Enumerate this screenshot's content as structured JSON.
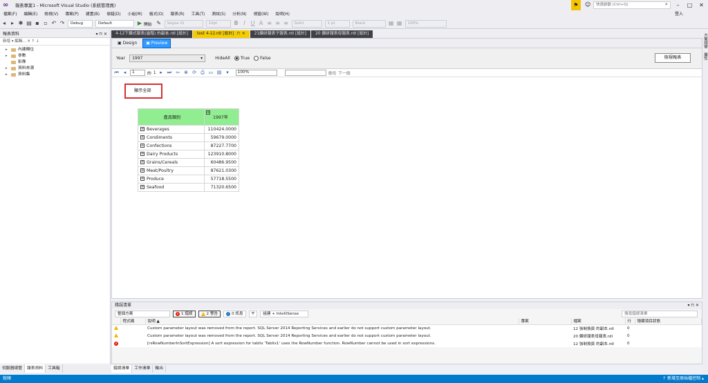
{
  "window": {
    "title": "報表專案1 - Microsoft Visual Studio (系統管理員)",
    "quick_launch_placeholder": "快速啟動 (Ctrl+Q)",
    "sign_in": "登入"
  },
  "menu": [
    "檔案(F)",
    "編輯(E)",
    "檢視(V)",
    "專案(P)",
    "建置(B)",
    "偵錯(D)",
    "小組(M)",
    "格式(O)",
    "報表(R)",
    "工具(T)",
    "測試(S)",
    "分析(N)",
    "視窗(W)",
    "說明(H)"
  ],
  "toolbar": {
    "config": "Debug",
    "platform": "Default",
    "start_label": "開始",
    "font": "Segoe UI",
    "font_size": "10pt",
    "border_style": "Solid",
    "border_width": "1 pt",
    "color": "Black",
    "zoom": "100%"
  },
  "left_panel": {
    "title": "報表資料",
    "subtool": "新增 ▾  編輯...  ✕  ↑  ↓",
    "items": [
      {
        "label": "內建欄位",
        "expandable": true
      },
      {
        "label": "參數",
        "expandable": true
      },
      {
        "label": "影像",
        "expandable": false
      },
      {
        "label": "資料來源",
        "expandable": true
      },
      {
        "label": "資料集",
        "expandable": true
      }
    ],
    "bottom_tabs": [
      "伺服器總管",
      "報表資料",
      "工具箱"
    ]
  },
  "doc_tabs": [
    {
      "label": "4-12下鑽式報表(進階) 的副本.rdl [設計]",
      "state": "normal"
    },
    {
      "label": "test 4-12.rdl [設計]",
      "state": "active"
    },
    {
      "label": "21鑽研報表子報表.rdl [設計]",
      "state": "normal"
    },
    {
      "label": "20 鑽研報表母報表.rdl [設計]",
      "state": "normal"
    }
  ],
  "view_tabs": {
    "design": "Design",
    "preview": "Preview"
  },
  "params": {
    "year_label": "Year",
    "year_value": "1997",
    "hideall_label": "HideAll",
    "true_label": "True",
    "false_label": "False",
    "selected": "True",
    "view_report": "檢視報表"
  },
  "report_toolbar": {
    "page_current": "1",
    "page_of": "的",
    "page_total": "1",
    "zoom": "100%",
    "find": "尋找",
    "next": "下一個"
  },
  "report": {
    "show_all": "顯示全部",
    "col_header": "產品類別",
    "year_header": "1997年",
    "rows": [
      {
        "category": "Beverages",
        "value": "110424.0000"
      },
      {
        "category": "Condiments",
        "value": "59679.0000"
      },
      {
        "category": "Confections",
        "value": "87227.7700"
      },
      {
        "category": "Dairy Products",
        "value": "123910.8000"
      },
      {
        "category": "Grains/Cereals",
        "value": "60486.9500"
      },
      {
        "category": "Meat/Poultry",
        "value": "87621.0300"
      },
      {
        "category": "Produce",
        "value": "57718.5500"
      },
      {
        "category": "Seafood",
        "value": "71320.6500"
      }
    ],
    "header_color": "#90ee90"
  },
  "error_list": {
    "title": "錯誤清單",
    "scope": "整個方案",
    "errors_btn": "1 錯誤",
    "warnings_btn": "2 警告",
    "messages_btn": "0 訊息",
    "build_filter": "組建 + IntelliSense",
    "search_placeholder": "搜尋錯誤清單",
    "columns": [
      "",
      "程式碼",
      "說明 ▲",
      "專案",
      "檔案",
      "行",
      "隱藏項目狀態"
    ],
    "rows": [
      {
        "kind": "warning",
        "description": "Custom parameter layout was removed from the report. SQL Server 2014 Reporting Services and earlier do not support custom parameter layout.",
        "file": "12 強制換頁 的副本.rdl",
        "line": "0"
      },
      {
        "kind": "warning",
        "description": "Custom parameter layout was removed from the report. SQL Server 2014 Reporting Services and earlier do not support custom parameter layout.",
        "file": "20 鑽研報表母報表.rdl",
        "line": "0"
      },
      {
        "kind": "error",
        "description": "[rsRowNumberInSortExpression] A sort expression for tablix 'Tablix1' uses the RowNumber function.  RowNumber cannot be used in sort expressions.",
        "file": "12 強制換頁 的副本.rdl",
        "line": "0"
      }
    ],
    "bottom_tabs": [
      "錯誤清單",
      "工作清單",
      "輸出"
    ]
  },
  "right_rail": [
    "方案總管",
    "屬性"
  ],
  "status": {
    "left": "就緒",
    "right": "↑ 新增至原始檔控制 ▴"
  },
  "colors": {
    "accent": "#007acc",
    "active_tab": "#f5cc00",
    "error": "#e51400",
    "warning": "#f5b400"
  }
}
